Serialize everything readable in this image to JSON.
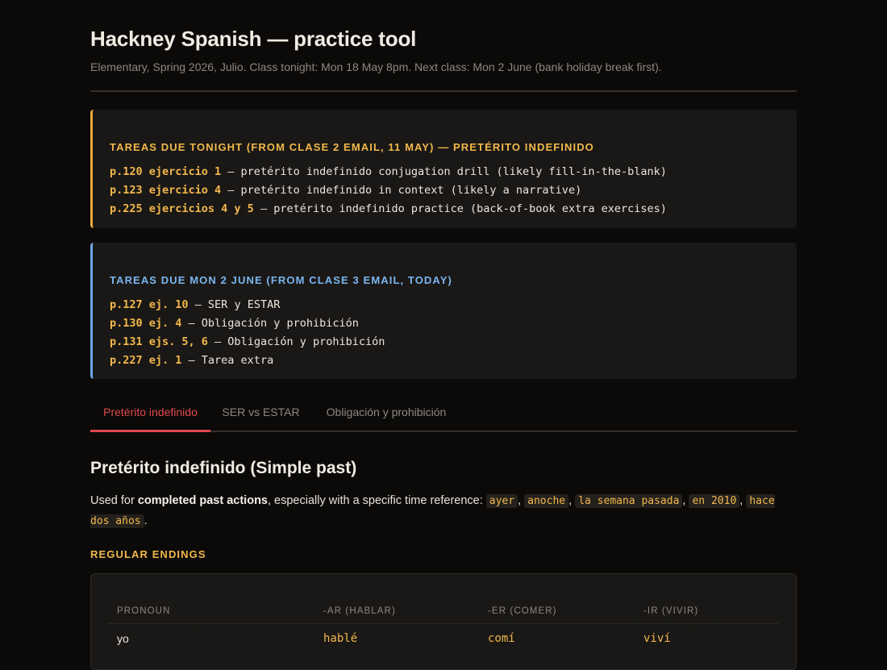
{
  "header": {
    "title": "Hackney Spanish — practice tool",
    "subtitle": "Elementary, Spring 2026, Julio. Class tonight: Mon 18 May 8pm. Next class: Mon 2 June (bank holiday break first)."
  },
  "homework_tonight": {
    "title": "Tareas due tonight (from Clase 2 email, 11 May) — Pretérito indefinido",
    "items": [
      {
        "ref": "p.120 ejercicio 1",
        "desc": " — pretérito indefinido conjugation drill (likely fill-in-the-blank)"
      },
      {
        "ref": "p.123 ejercicio 4",
        "desc": " — pretérito indefinido in context (likely a narrative)"
      },
      {
        "ref": "p.225 ejercicios 4 y 5",
        "desc": " — pretérito indefinido practice (back-of-book extra exercises)"
      }
    ]
  },
  "homework_june": {
    "title": "Tareas due Mon 2 June (from Clase 3 email, today)",
    "items": [
      {
        "ref": "p.127 ej. 10",
        "desc": " — SER y ESTAR"
      },
      {
        "ref": "p.130 ej. 4",
        "desc": " — Obligación y prohibición"
      },
      {
        "ref": "p.131 ejs. 5, 6",
        "desc": " — Obligación y prohibición"
      },
      {
        "ref": "p.227 ej. 1",
        "desc": " — Tarea extra"
      }
    ]
  },
  "tabs": [
    {
      "label": "Pretérito indefinido",
      "active": true
    },
    {
      "label": "SER vs ESTAR",
      "active": false
    },
    {
      "label": "Obligación y prohibición",
      "active": false
    }
  ],
  "lesson": {
    "heading": "Pretérito indefinido (Simple past)",
    "intro_pre": "Used for ",
    "intro_bold": "completed past actions",
    "intro_post": ", especially with a specific time reference: ",
    "time_refs": [
      "ayer",
      "anoche",
      "la semana pasada",
      "en 2010",
      "hace dos años"
    ],
    "intro_end": ".",
    "regular_label": "REGULAR ENDINGS",
    "table": {
      "headers": [
        "PRONOUN",
        "-AR (HABLAR)",
        "-ER (COMER)",
        "-IR (VIVIR)"
      ],
      "rows": [
        [
          "yo",
          "hablé",
          "comí",
          "viví"
        ]
      ]
    }
  },
  "colors": {
    "accent_orange": "#f2b84b",
    "accent_blue": "#7ab6f0",
    "tab_active": "#e0484d",
    "background": "#0b0a09"
  }
}
